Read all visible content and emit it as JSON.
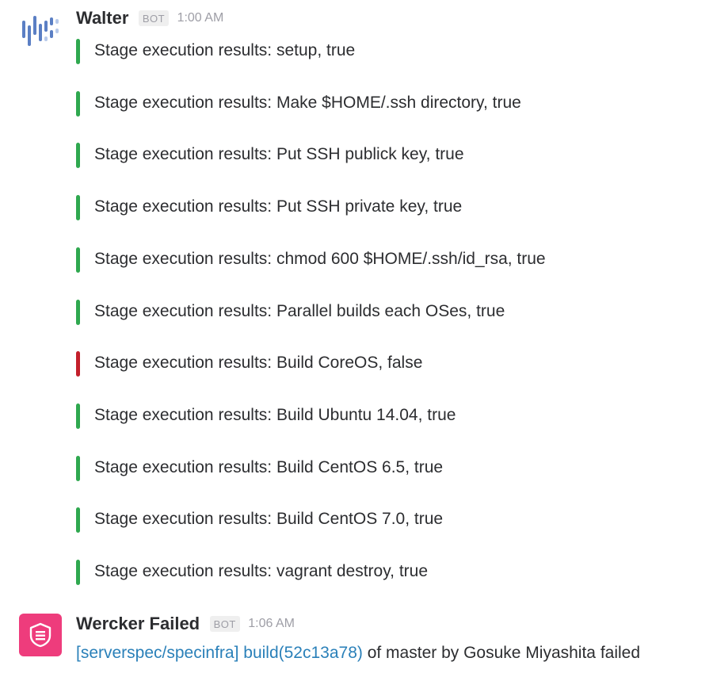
{
  "messages": [
    {
      "sender": "Walter",
      "badge": "BOT",
      "time": "1:00 AM",
      "avatar_icon": "walter-logo-icon",
      "attachments": [
        {
          "text": "Stage execution results: setup, true",
          "status": "success",
          "color": "#2fa84f"
        },
        {
          "text": "Stage execution results: Make $HOME/.ssh directory, true",
          "status": "success",
          "color": "#2fa84f"
        },
        {
          "text": "Stage execution results: Put SSH publick key, true",
          "status": "success",
          "color": "#2fa84f"
        },
        {
          "text": "Stage execution results: Put SSH private key, true",
          "status": "success",
          "color": "#2fa84f"
        },
        {
          "text": "Stage execution results: chmod 600 $HOME/.ssh/id_rsa, true",
          "status": "success",
          "color": "#2fa84f"
        },
        {
          "text": "Stage execution results: Parallel builds each OSes, true",
          "status": "success",
          "color": "#2fa84f"
        },
        {
          "text": "Stage execution results: Build CoreOS, false",
          "status": "failure",
          "color": "#c3202b"
        },
        {
          "text": "Stage execution results: Build Ubuntu 14.04, true",
          "status": "success",
          "color": "#2fa84f"
        },
        {
          "text": "Stage execution results: Build CentOS 6.5, true",
          "status": "success",
          "color": "#2fa84f"
        },
        {
          "text": "Stage execution results: Build CentOS 7.0, true",
          "status": "success",
          "color": "#2fa84f"
        },
        {
          "text": "Stage execution results: vagrant destroy, true",
          "status": "success",
          "color": "#2fa84f"
        }
      ]
    },
    {
      "sender": "Wercker Failed",
      "badge": "BOT",
      "time": "1:06 AM",
      "avatar_icon": "wercker-logo-icon",
      "avatar_color": "#ee3c7c",
      "body": {
        "repo_link": "[serverspec/specinfra]",
        "build_link": "build(52c13a78)",
        "rest": " of master by Gosuke Miyashita failed"
      }
    }
  ],
  "colors": {
    "link": "#2a80b9",
    "success": "#2fa84f",
    "failure": "#c3202b"
  }
}
